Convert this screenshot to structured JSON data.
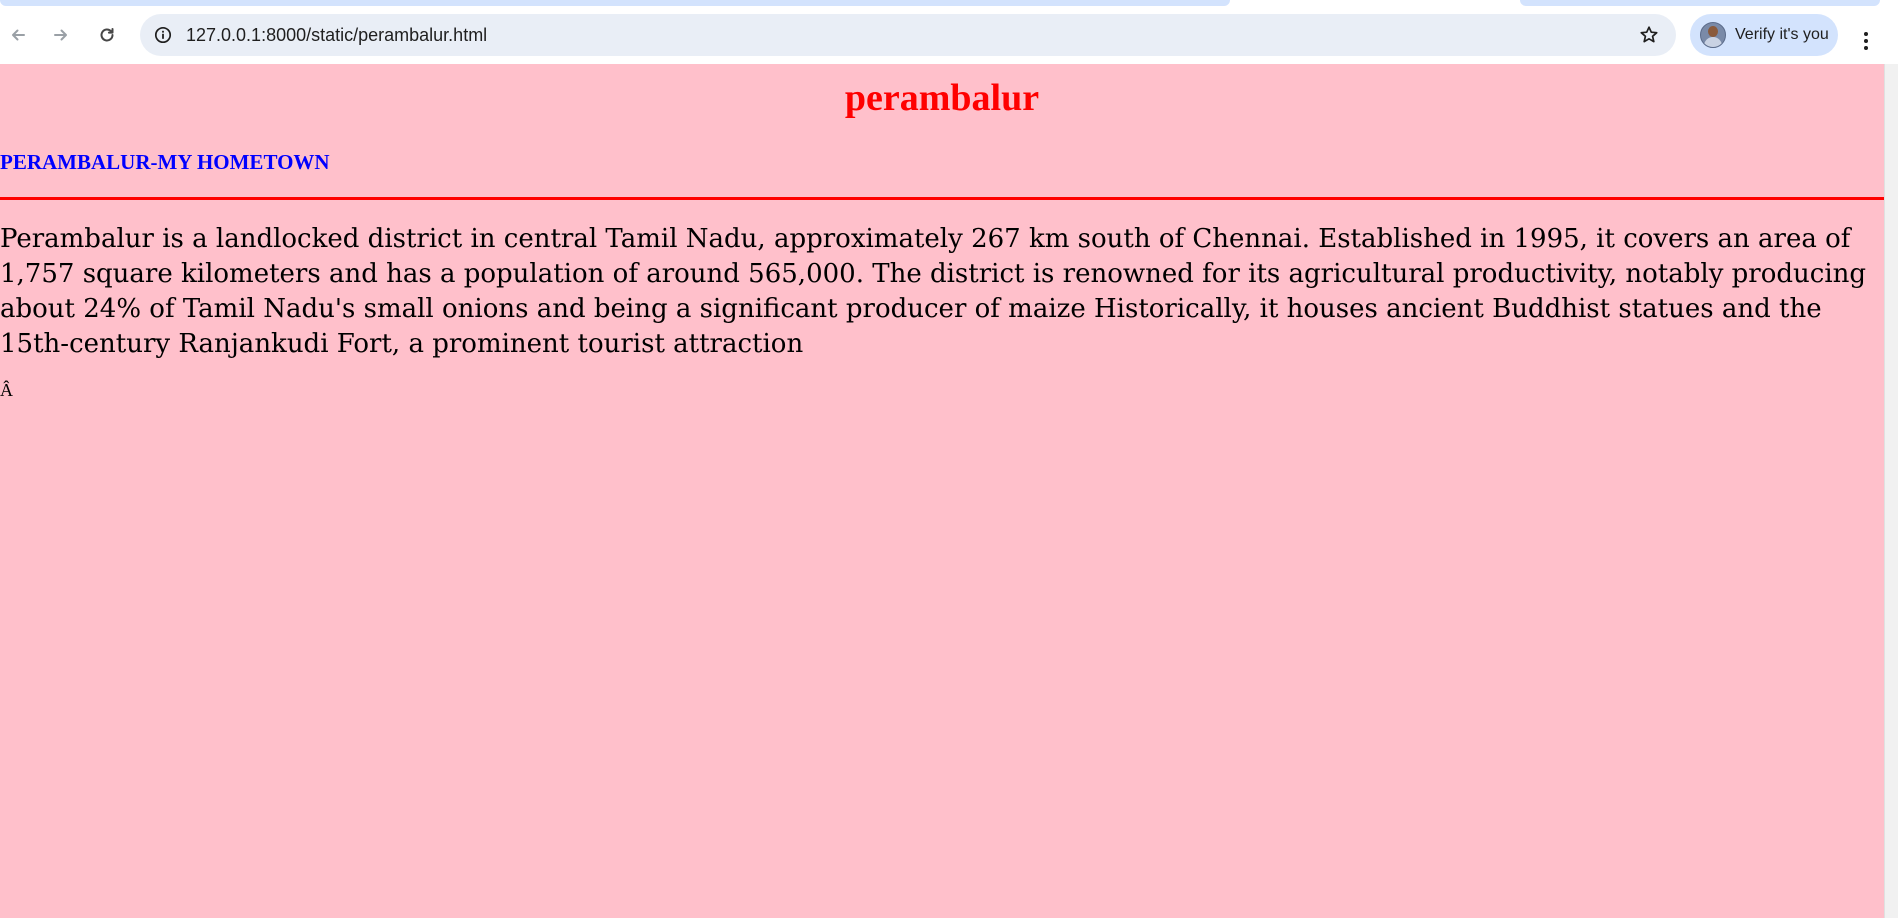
{
  "browser": {
    "address_bar": {
      "url": "127.0.0.1:8000/static/perambalur.html"
    },
    "profile_chip": {
      "label": "Verify it's you"
    },
    "icons": {
      "back": "arrow-left-icon",
      "forward": "arrow-right-icon",
      "reload": "reload-icon",
      "site_info": "info-icon",
      "bookmark": "star-icon",
      "menu": "kebab-menu-icon"
    }
  },
  "page": {
    "title": "perambalur",
    "subtitle": "PERAMBALUR-MY HOMETOWN",
    "description": "Perambalur is a landlocked district in central Tamil Nadu, approximately 267 km south of Chennai. Established in 1995, it covers an area of 1,757 square kilometers and has a population of around 565,000. The district is renowned for its agricultural productivity, notably producing about 24% of Tamil Nadu's small onions and being a significant producer of maize Historically, it houses ancient Buddhist statues and the 15th-century Ranjankudi Fort, a prominent tourist attraction",
    "stray_text": "Â"
  },
  "colors": {
    "page_background": "#ffc0cb",
    "title": "#ff0000",
    "subtitle": "#0000ff",
    "rule": "#ff0000",
    "omnibox_background": "#e9eef6",
    "chip_background": "#d3e3fd"
  }
}
